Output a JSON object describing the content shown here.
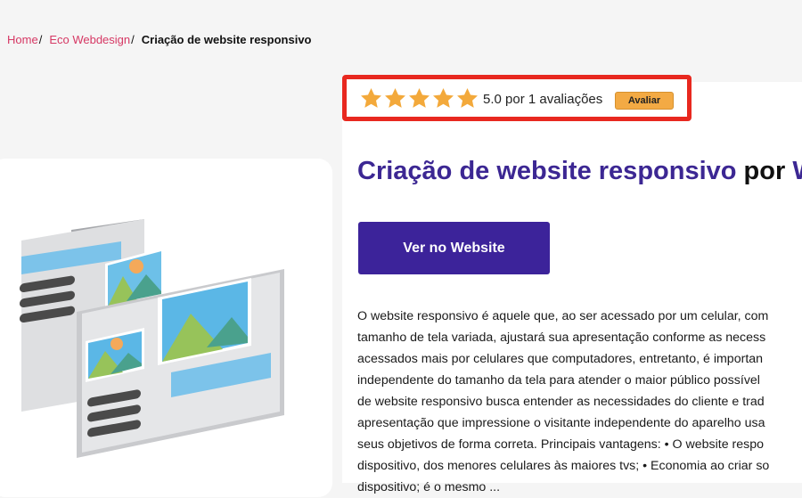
{
  "breadcrumb": {
    "home": "Home",
    "category": "Eco Webdesign",
    "current": "Criação de website responsivo",
    "separator": "/"
  },
  "rating": {
    "stars": 5,
    "star_color": "#f3a93b",
    "text": "5.0 por 1 avaliações",
    "rate_button": "Avaliar"
  },
  "product": {
    "title_main": "Criação de website responsivo",
    "title_por": "por",
    "title_vendor": "We",
    "cta_label": "Ver no Website"
  },
  "description_lines": [
    "O website responsivo é aquele que, ao ser acessado por um celular, com",
    "tamanho de tela variada, ajustará sua apresentação conforme as necess",
    "acessados mais por celulares que computadores, entretanto, é importan",
    "independente do tamanho da tela para atender o maior público possível",
    "de website responsivo busca entender as necessidades do cliente e trad",
    "apresentação que impressione o visitante independente do aparelho usa",
    "seus objetivos de forma correta. Principais vantagens: • O website respo",
    "dispositivo, dos menores celulares às maiores tvs; • Economia ao criar so",
    "dispositivo; é o mesmo ... "
  ],
  "colors": {
    "accent": "#3c239a",
    "link": "#d63864",
    "highlight_border": "#e8281f",
    "rate_button": "#f3aa44"
  },
  "icons": {
    "star": "star-icon",
    "illustration": "responsive-devices-illustration"
  }
}
